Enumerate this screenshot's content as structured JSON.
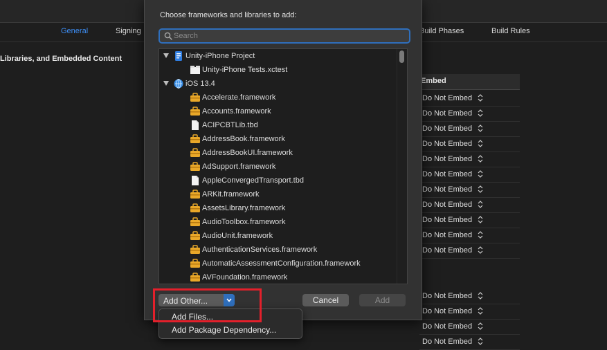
{
  "editor": {
    "tabs": [
      {
        "label": "General",
        "active": true
      },
      {
        "label": "Signing",
        "active": false
      },
      {
        "label": "Build Phases",
        "active": false
      },
      {
        "label": "Build Rules",
        "active": false
      }
    ],
    "section_title": "Libraries, and Embedded Content",
    "embed_header": "Embed",
    "embed_value": "Do Not Embed",
    "accent_color": "#3d8ef5"
  },
  "sheet": {
    "title": "Choose frameworks and libraries to add:",
    "search_placeholder": "Search",
    "items": [
      {
        "label": "Unity-iPhone Project",
        "level": 0,
        "icon": "project-icon",
        "expanded": true
      },
      {
        "label": "Unity-iPhone Tests.xctest",
        "level": 1,
        "icon": "bundle-icon"
      },
      {
        "label": "iOS 13.4",
        "level": 0,
        "icon": "sdk-icon",
        "expanded": true
      },
      {
        "label": "Accelerate.framework",
        "level": 1,
        "icon": "framework-icon"
      },
      {
        "label": "Accounts.framework",
        "level": 1,
        "icon": "framework-icon"
      },
      {
        "label": "ACIPCBTLib.tbd",
        "level": 1,
        "icon": "file-icon"
      },
      {
        "label": "AddressBook.framework",
        "level": 1,
        "icon": "framework-icon"
      },
      {
        "label": "AddressBookUI.framework",
        "level": 1,
        "icon": "framework-icon"
      },
      {
        "label": "AdSupport.framework",
        "level": 1,
        "icon": "framework-icon"
      },
      {
        "label": "AppleConvergedTransport.tbd",
        "level": 1,
        "icon": "file-icon"
      },
      {
        "label": "ARKit.framework",
        "level": 1,
        "icon": "framework-icon"
      },
      {
        "label": "AssetsLibrary.framework",
        "level": 1,
        "icon": "framework-icon"
      },
      {
        "label": "AudioToolbox.framework",
        "level": 1,
        "icon": "framework-icon"
      },
      {
        "label": "AudioUnit.framework",
        "level": 1,
        "icon": "framework-icon"
      },
      {
        "label": "AuthenticationServices.framework",
        "level": 1,
        "icon": "framework-icon"
      },
      {
        "label": "AutomaticAssessmentConfiguration.framework",
        "level": 1,
        "icon": "framework-icon"
      },
      {
        "label": "AVFoundation.framework",
        "level": 1,
        "icon": "framework-icon"
      }
    ],
    "add_other_label": "Add Other...",
    "cancel_label": "Cancel",
    "add_label": "Add"
  },
  "menu": {
    "items": [
      "Add Files...",
      "Add Package Dependency..."
    ]
  },
  "highlight_color": "#e3202b"
}
